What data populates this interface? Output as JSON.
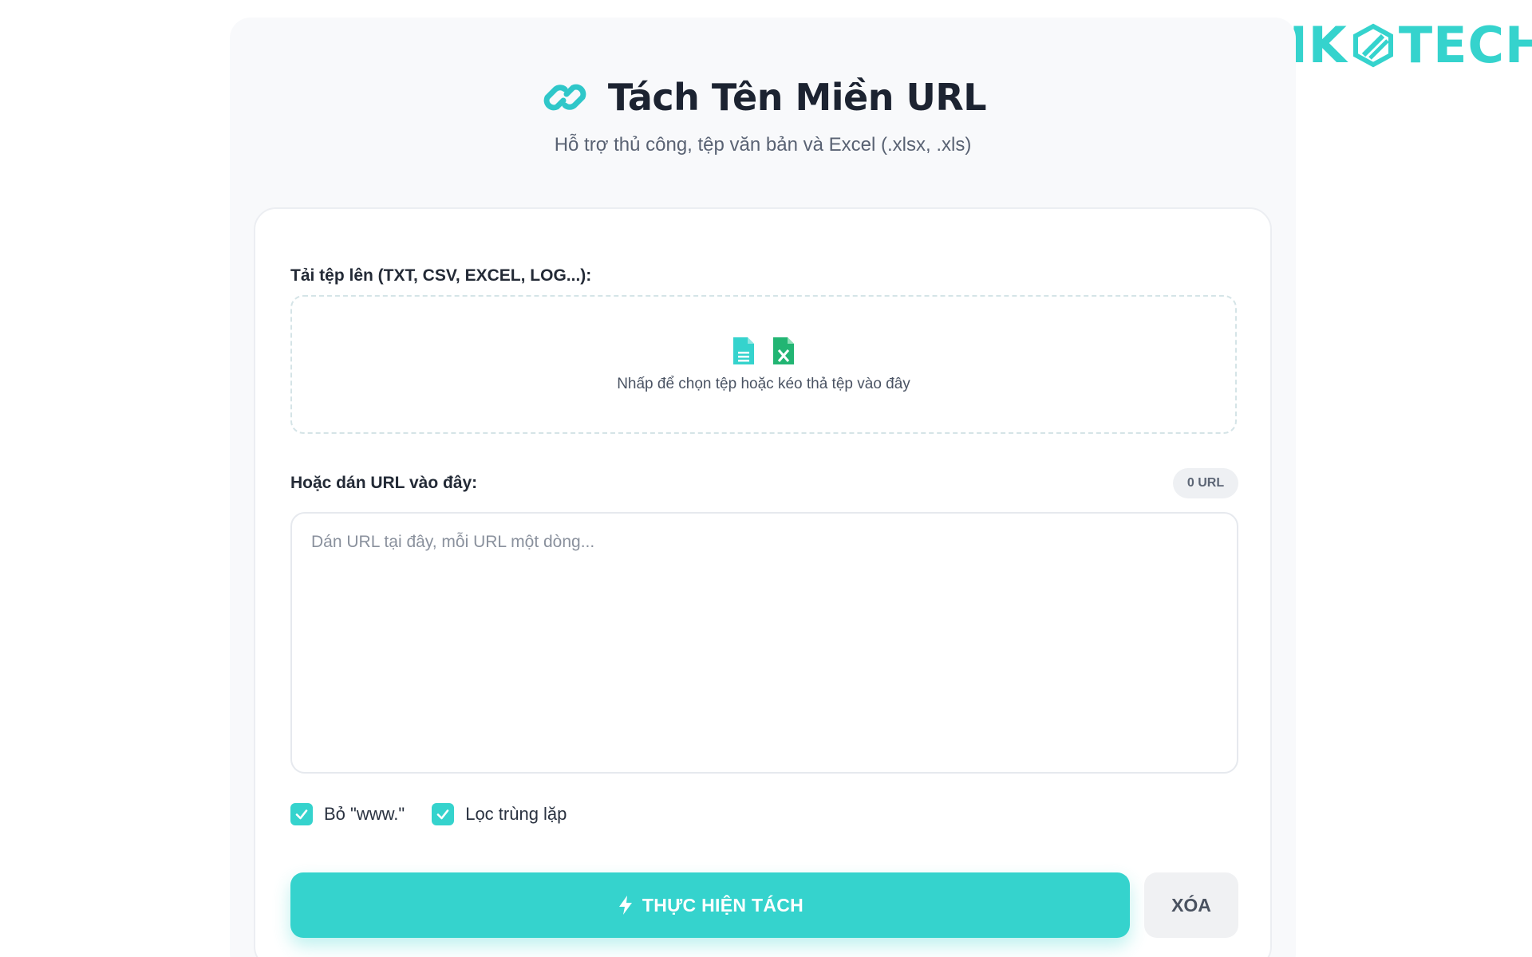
{
  "brand": {
    "logo_left": "MIK",
    "logo_right": "TECH",
    "accent_color": "#35d3cd"
  },
  "header": {
    "icon": "link-icon",
    "title": "Tách Tên Miền URL",
    "subtitle": "Hỗ trợ thủ công, tệp văn bản và Excel (.xlsx, .xls)"
  },
  "upload": {
    "label": "Tải tệp lên (TXT, CSV, EXCEL, LOG...):",
    "icons": [
      "text-file-icon",
      "excel-file-icon"
    ],
    "drop_text": "Nhấp để chọn tệp hoặc kéo thả tệp vào đây"
  },
  "paste": {
    "label": "Hoặc dán URL vào đây:",
    "count_badge": "0 URL",
    "placeholder": "Dán URL tại đây, mỗi URL một dòng...",
    "value": ""
  },
  "options": [
    {
      "label": "Bỏ \"www.\"",
      "checked": true
    },
    {
      "label": "Lọc trùng lặp",
      "checked": true
    }
  ],
  "actions": {
    "run_label": "THỰC HIỆN TÁCH",
    "run_icon": "bolt-icon",
    "clear_label": "XÓA"
  }
}
